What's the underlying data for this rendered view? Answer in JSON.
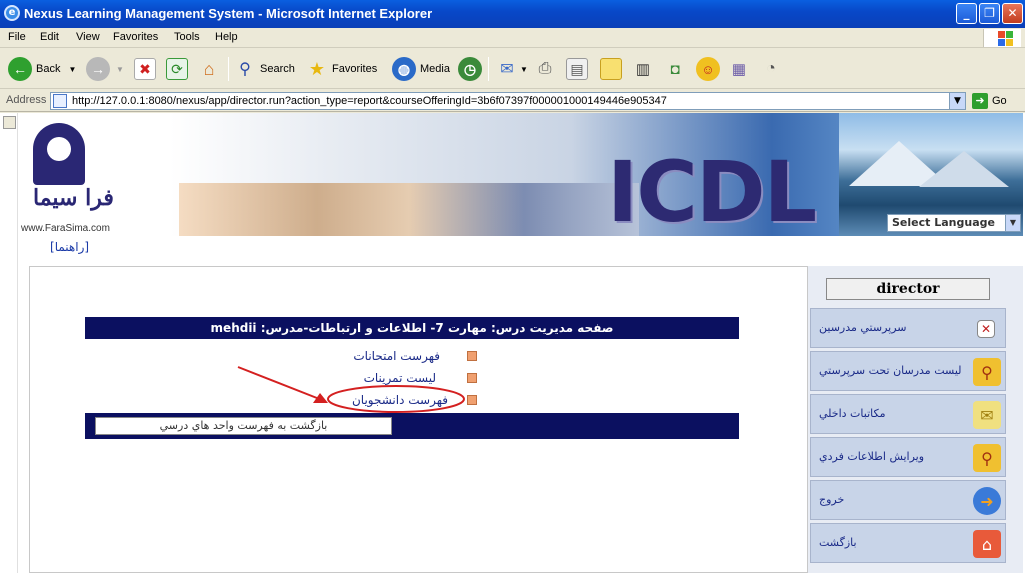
{
  "window": {
    "title": "Nexus Learning Management System - Microsoft Internet Explorer",
    "controls": [
      "_",
      "❐",
      "✕"
    ]
  },
  "menu": [
    "File",
    "Edit",
    "View",
    "Favorites",
    "Tools",
    "Help"
  ],
  "toolbar": {
    "back": "Back",
    "search": "Search",
    "favorites": "Favorites",
    "media": "Media"
  },
  "address": {
    "label": "Address",
    "url": "http://127.0.0.1:8080/nexus/app/director.run?action_type=report&courseOfferingId=3b6f07397f000001000149446e905347",
    "go": "Go"
  },
  "banner": {
    "logo_text": "فرا سيما",
    "site": "www.FaraSima.com",
    "icdl": "ICDL",
    "language_select": "Select Language"
  },
  "help_link": "[راهنما]",
  "main": {
    "header": "صفحه مديريت درس: مهارت 7- اطلاعات و ارتباطات-مدرس: mehdii",
    "links": [
      "فهرست امتحانات",
      "ليست تمرينات",
      "فهرست دانشجويان"
    ],
    "back_button": "بازگشت به فهرست واحد هاي درسي"
  },
  "sidebar": {
    "user": "director",
    "items": [
      {
        "label": "سرپرستي مدرسين",
        "icon": "close-box-icon"
      },
      {
        "label": "ليست مدرسان تحت سرپرستي",
        "icon": "magnifier-icon"
      },
      {
        "label": "مکاتبات داخلي",
        "icon": "envelope-icon"
      },
      {
        "label": "ويرايش اطلاعات فردي",
        "icon": "magnifier-icon"
      },
      {
        "label": "خروج",
        "icon": "exit-icon"
      },
      {
        "label": "بازگشت",
        "icon": "home-icon"
      }
    ]
  },
  "colors": {
    "title_bar": "#0848c8",
    "header_navy": "#0b1060",
    "link": "#1a2a88",
    "annotation": "#d42020",
    "sidebar_item": "#c8d4e8"
  }
}
